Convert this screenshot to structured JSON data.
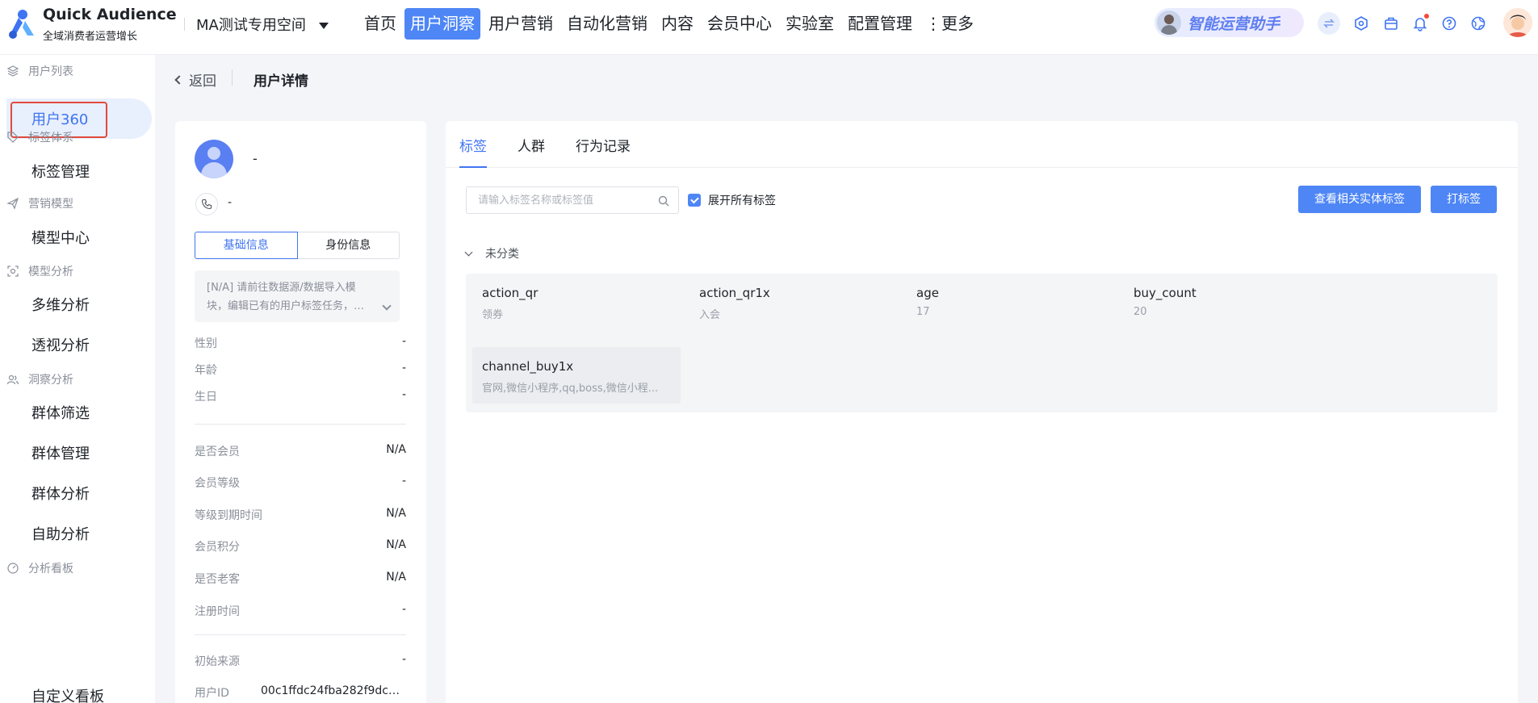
{
  "brand": {
    "name": "Quick Audience",
    "subtitle": "全域消费者运营增长"
  },
  "workspace": "MA测试专用空间",
  "nav": {
    "items": [
      {
        "label": "首页"
      },
      {
        "label": "用户洞察"
      },
      {
        "label": "用户营销"
      },
      {
        "label": "自动化营销"
      },
      {
        "label": "内容"
      },
      {
        "label": "会员中心"
      },
      {
        "label": "实验室"
      },
      {
        "label": "配置管理"
      }
    ],
    "active": "用户洞察",
    "more": "⋮更多"
  },
  "assistant": {
    "label": "智能运营助手"
  },
  "icons": {
    "switch": "switch-arrows-icon",
    "app": "app-hub-icon",
    "box": "toolbox-icon",
    "bell": "bell-icon",
    "help": "help-circle-icon",
    "globe": "globe-icon"
  },
  "sidebar": {
    "groups": [
      {
        "title": "用户列表",
        "items": [
          "用户360"
        ]
      },
      {
        "title": "标签体系",
        "items": [
          "标签管理"
        ]
      },
      {
        "title": "营销模型",
        "items": [
          "模型中心"
        ]
      },
      {
        "title": "模型分析",
        "items": [
          "多维分析",
          "透视分析"
        ]
      },
      {
        "title": "洞察分析",
        "items": [
          "群体筛选",
          "群体管理",
          "群体分析",
          "自助分析"
        ]
      },
      {
        "title": "分析看板",
        "items": [
          "自定义看板"
        ]
      }
    ],
    "active": "用户360"
  },
  "page": {
    "back": "返回",
    "title": "用户详情"
  },
  "profile": {
    "name": "-",
    "phone": "-",
    "tabs": [
      "基础信息",
      "身份信息"
    ],
    "active_tab": "基础信息",
    "note": "[N/A] 请前往数据源/数据导入模块，编辑已有的用户标签任务，…",
    "fields_basic": [
      {
        "label": "性别",
        "value": "-"
      },
      {
        "label": "年龄",
        "value": "-"
      },
      {
        "label": "生日",
        "value": "-"
      }
    ],
    "fields_member": [
      {
        "label": "是否会员",
        "value": "N/A"
      },
      {
        "label": "会员等级",
        "value": "-"
      },
      {
        "label": "等级到期时间",
        "value": "N/A"
      },
      {
        "label": "会员积分",
        "value": "N/A"
      },
      {
        "label": "是否老客",
        "value": "N/A"
      },
      {
        "label": "注册时间",
        "value": "-"
      }
    ],
    "fields_source": [
      {
        "label": "初始来源",
        "value": "-"
      },
      {
        "label": "用户ID",
        "value": "00c1ffdc24fba282f9dc1..."
      }
    ]
  },
  "tags_panel": {
    "tabs": [
      "标签",
      "人群",
      "行为记录"
    ],
    "active_tab": "标签",
    "search_placeholder": "请输入标签名称或标签值",
    "expand_all_label": "展开所有标签",
    "expand_all_checked": true,
    "btn_related": "查看相关实体标签",
    "btn_tag": "打标签",
    "category": "未分类",
    "tags": [
      {
        "name": "action_qr",
        "value": "领券"
      },
      {
        "name": "action_qr1x",
        "value": "入会"
      },
      {
        "name": "age",
        "value": "17"
      },
      {
        "name": "buy_count",
        "value": "20"
      },
      {
        "name": "channel_buy1x",
        "value": "官网,微信小程序,qq,boss,微信小程..."
      }
    ]
  },
  "colors": {
    "accent": "#4e86f5",
    "highlight_border": "#e14a3b"
  }
}
